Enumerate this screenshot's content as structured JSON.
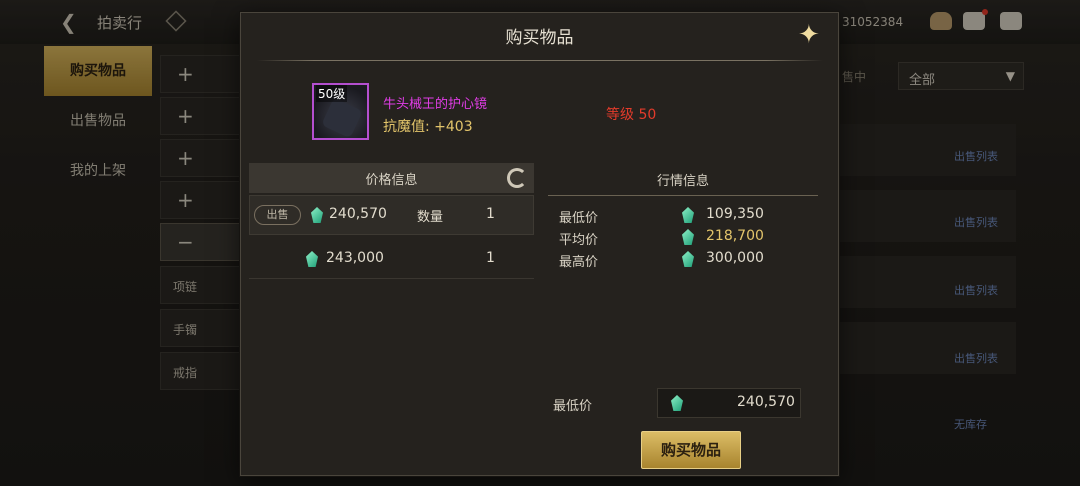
{
  "background": {
    "title": "拍卖行",
    "currency_value": "31052384",
    "sidebar": [
      {
        "label": "购买物品",
        "active": true
      },
      {
        "label": "出售物品",
        "active": false
      },
      {
        "label": "我的上架",
        "active": false
      }
    ],
    "categories": [
      "+",
      "+",
      "+",
      "+",
      "−",
      "项链",
      "手镯",
      "戒指"
    ],
    "filter_label": "售中",
    "filter_value": "全部",
    "row_links": [
      "出售列表",
      "出售列表",
      "出售列表",
      "出售列表",
      "无库存"
    ]
  },
  "modal": {
    "title": "购买物品",
    "item": {
      "level_badge": "50级",
      "name": "牛头械王的护心镜",
      "stat": "抗魔值: +403",
      "requirement": "等级 50"
    },
    "price_panel": {
      "header": "价格信息",
      "rows": [
        {
          "badge": "出售",
          "price": "240,570",
          "qty_label": "数量",
          "qty": "1"
        },
        {
          "badge": "",
          "price": "243,000",
          "qty_label": "",
          "qty": "1"
        }
      ]
    },
    "market_panel": {
      "header": "行情信息",
      "rows": [
        {
          "label": "最低价",
          "value": "109,350"
        },
        {
          "label": "平均价",
          "value": "218,700"
        },
        {
          "label": "最高价",
          "value": "300,000"
        }
      ]
    },
    "min_price_label": "最低价",
    "min_price_value": "240,570",
    "buy_button": "购买物品"
  },
  "colors": {
    "gold_button": "#c9a348",
    "item_name": "#e03de6",
    "stat": "#e3c56b",
    "requirement": "#e33b2b",
    "gem": "#2fc59a"
  },
  "icons": [
    "back-arrow-icon",
    "diamond-icon",
    "bag-icon",
    "mail-icon",
    "chat-icon",
    "close-icon",
    "refresh-icon",
    "gem-icon"
  ]
}
